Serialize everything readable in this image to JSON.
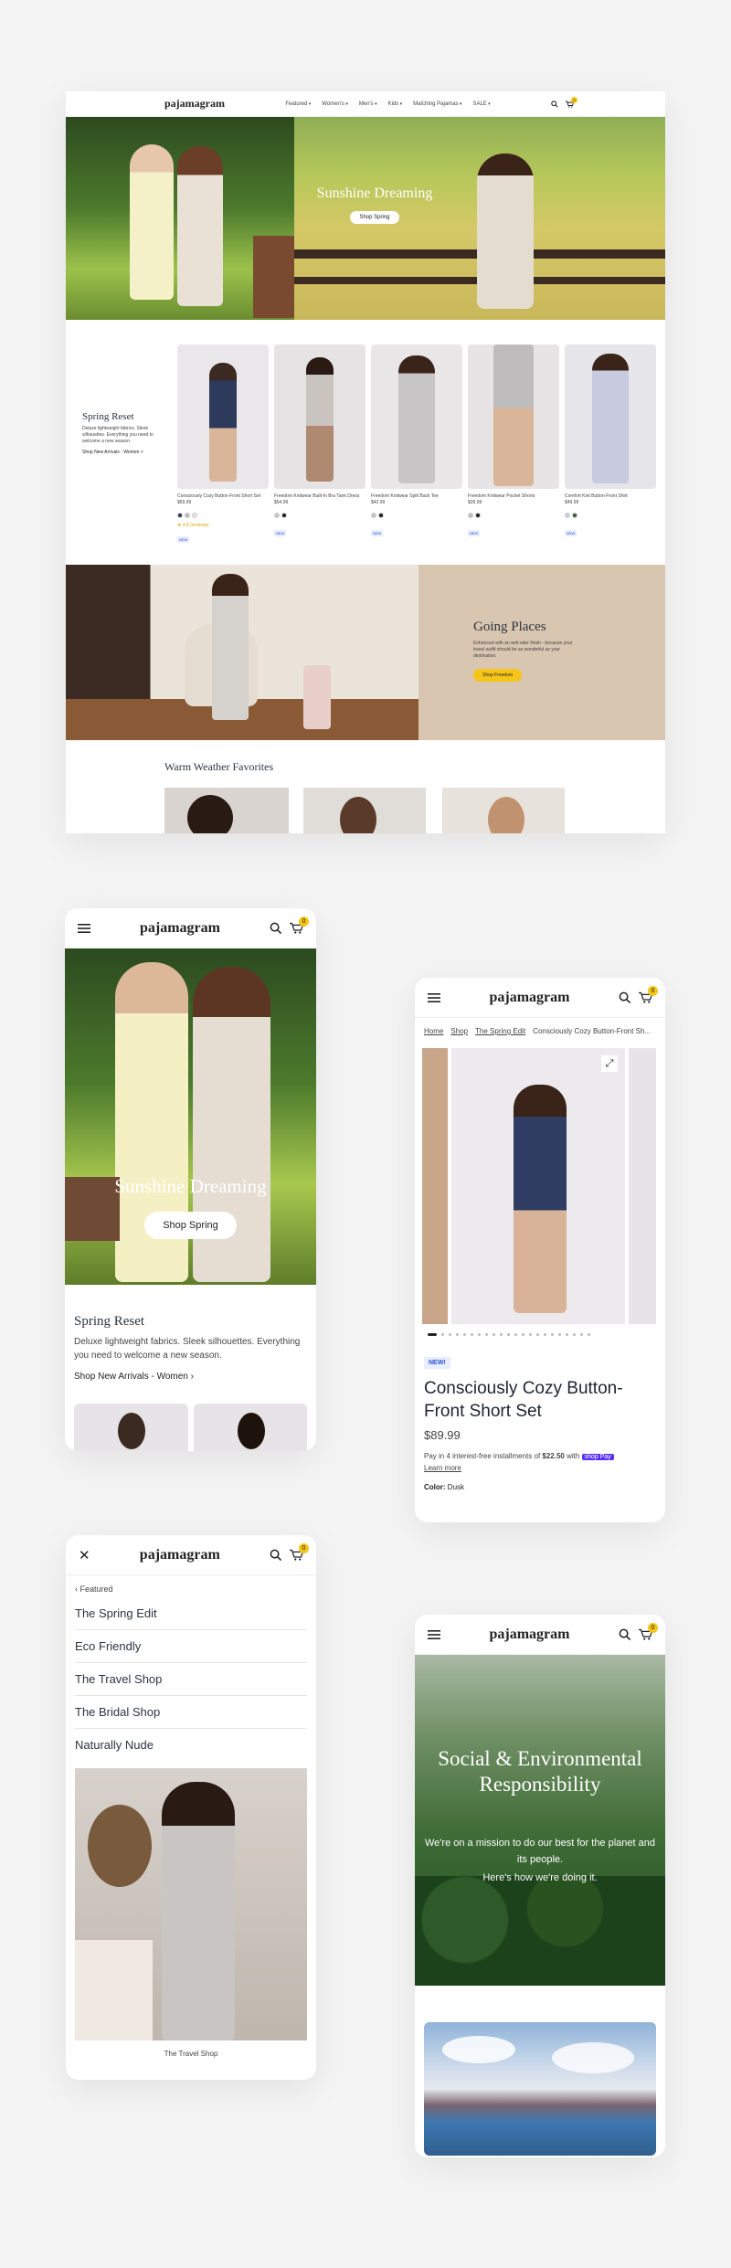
{
  "brand": {
    "name": "pajamagram",
    "cart_count": "0",
    "accent": "#f5c518"
  },
  "desktop": {
    "nav": [
      "Featured",
      "Women's",
      "Men's",
      "Kids",
      "Matching Pajamas",
      "SALE"
    ],
    "hero": {
      "title": "Sunshine Dreaming",
      "button": "Shop Spring"
    },
    "spring": {
      "title": "Spring Reset",
      "body": "Deluxe lightweight fabrics. Sleek silhouettes. Everything you need to welcome a new season.",
      "link": "Shop New Arrivals - Women >",
      "products": [
        {
          "name": "Consciously Cozy Button-Front Short Set",
          "price": "$69.99",
          "badge": "NEW",
          "rating": "★ 4.8 (reviews)"
        },
        {
          "name": "Freedom Knitwear Built-In Bra Tank Dress",
          "price": "$54.99",
          "badge": "NEW",
          "rating": ""
        },
        {
          "name": "Freedom Knitwear Split Back Tee",
          "price": "$42.99",
          "badge": "NEW",
          "rating": ""
        },
        {
          "name": "Freedom Knitwear Pocket Shorts",
          "price": "$39.99",
          "badge": "NEW",
          "rating": ""
        },
        {
          "name": "Comfort Knit Button-Front Shirt",
          "price": "$49.99",
          "badge": "NEW",
          "rating": ""
        }
      ]
    },
    "places": {
      "title": "Going Places",
      "body": "Enhanced with an anti-odor finish - because your travel outfit should be as wonderful as your destination.",
      "button": "Shop Freedom"
    },
    "warm": {
      "title": "Warm Weather Favorites"
    }
  },
  "mobile_home": {
    "hero_title": "Sunshine Dreaming",
    "hero_button": "Shop Spring",
    "spring_title": "Spring Reset",
    "spring_body": "Deluxe lightweight fabrics. Sleek silhouettes. Everything you need to welcome a new season.",
    "spring_link": "Shop New Arrivals - Women"
  },
  "mobile_product": {
    "breadcrumb": [
      "Home",
      "Shop",
      "The Spring Edit",
      "Consciously Cozy Button-Front Sh..."
    ],
    "badge": "NEW!",
    "title": "Consciously Cozy Button-Front Short Set",
    "price": "$89.99",
    "installments_pre": "Pay in 4 interest-free installments of",
    "installments_amount": "$22.50",
    "installments_with": "with",
    "shop_pay": "shop Pay",
    "learn_more": "Learn more",
    "color_label": "Color:",
    "color_value": "Dusk"
  },
  "mobile_menu": {
    "back": "Featured",
    "items": [
      "The Spring Edit",
      "Eco Friendly",
      "The Travel Shop",
      "The Bridal Shop",
      "Naturally Nude"
    ],
    "image_caption": "The Travel Shop"
  },
  "mobile_social": {
    "title": "Social & Environmental Responsibility",
    "body": "We're on a mission to do our best for the planet and its people.",
    "link": "Here's how we're doing it."
  }
}
